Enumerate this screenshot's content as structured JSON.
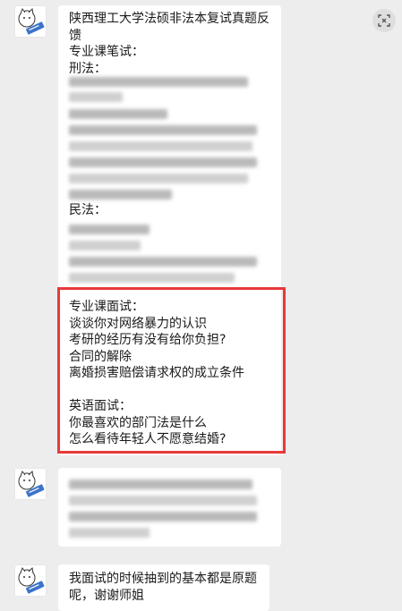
{
  "messages": [
    {
      "id": "m1",
      "lines": [
        "陕西理工大学法硕非法本复试真题反",
        "馈",
        "专业课笔试：",
        "刑法："
      ],
      "civil_label": "民法：",
      "interview": {
        "heading": "专业课面试：",
        "questions": [
          "谈谈你对网络暴力的认识",
          "考研的经历有没有给你负担?",
          "合同的解除",
          "离婚损害赔偿请求权的成立条件"
        ]
      },
      "english": {
        "heading": "英语面试：",
        "questions": [
          "你最喜欢的部门法是什么",
          "怎么看待年轻人不愿意结婚?"
        ]
      }
    },
    {
      "id": "m3",
      "lines": [
        "我面试的时候抽到的基本都是原题",
        "呢，谢谢师姐"
      ]
    }
  ],
  "colors": {
    "highlight_border": "#e8393a",
    "chat_bg": "#ededed"
  },
  "icons": {
    "top_right": "scan-icon",
    "avatar": "cartoon-avatar"
  }
}
